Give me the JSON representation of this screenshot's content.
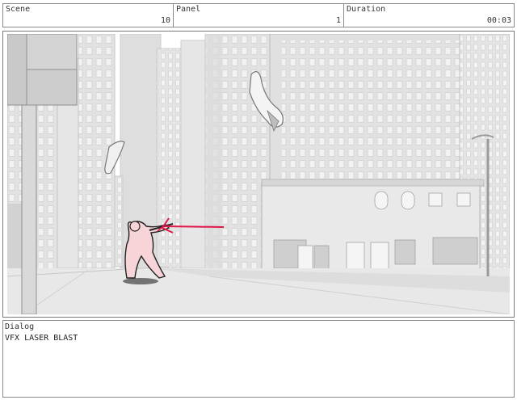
{
  "header": {
    "scene": {
      "label": "Scene",
      "value": "10"
    },
    "panel": {
      "label": "Panel",
      "value": "1"
    },
    "duration": {
      "label": "Duration",
      "value": "00:03"
    }
  },
  "dialog": {
    "label": "Dialog",
    "text": "VFX LASER BLAST"
  },
  "colors": {
    "laser": "#e0184a",
    "figure_fill": "#f7d4d8",
    "building_light": "#e9e9e9",
    "building_mid": "#d8d8d8",
    "outline": "#9a9a9a"
  }
}
